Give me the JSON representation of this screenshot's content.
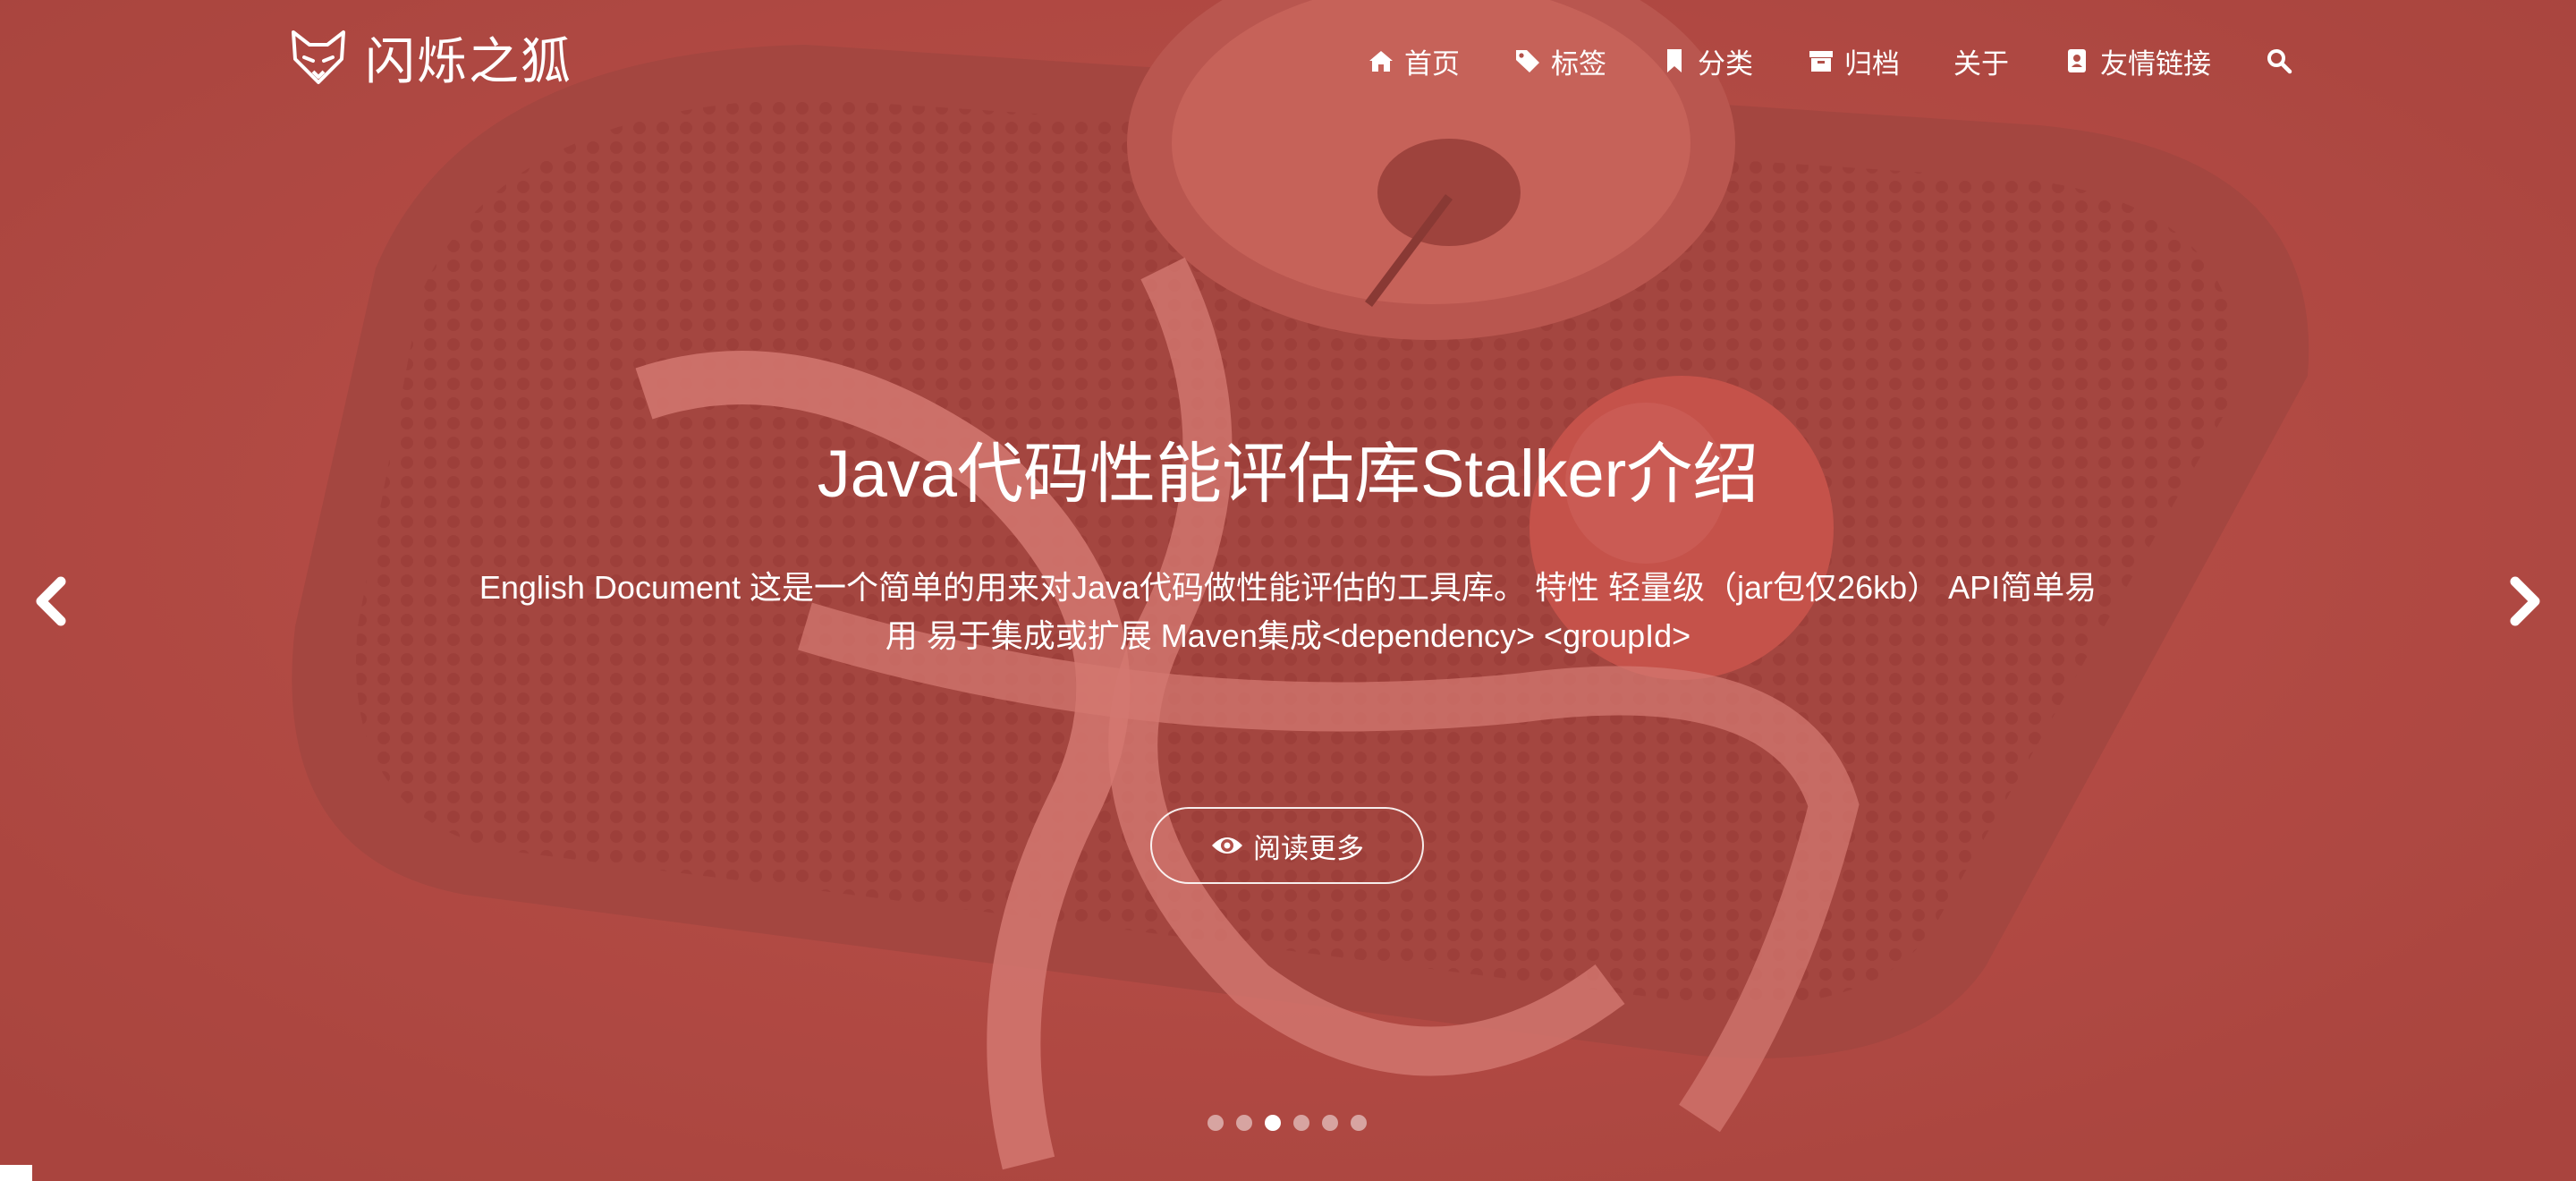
{
  "brand": {
    "name": "闪烁之狐",
    "logo_icon": "fox-head-icon"
  },
  "nav": {
    "items": [
      {
        "label": "首页",
        "icon": "home-icon"
      },
      {
        "label": "标签",
        "icon": "tags-icon"
      },
      {
        "label": "分类",
        "icon": "bookmark-icon"
      },
      {
        "label": "归档",
        "icon": "archive-icon"
      },
      {
        "label": "关于",
        "icon": ""
      },
      {
        "label": "友情链接",
        "icon": "address-card-icon"
      }
    ],
    "search_icon": "search-icon"
  },
  "carousel": {
    "title": "Java代码性能评估库Stalker介绍",
    "description": "English Document 这是一个简单的用来对Java代码做性能评估的工具库。 特性 轻量级（jar包仅26kb） API简单易用 易于集成或扩展 Maven集成<dependency> <groupId>",
    "read_more_label": "阅读更多",
    "read_more_icon": "eye-icon",
    "prev_icon": "chevron-left-icon",
    "next_icon": "chevron-right-icon",
    "slide_count": 6,
    "active_index": 2
  },
  "colors": {
    "overlay": "#c8504a",
    "background": "#a84942",
    "text": "#ffffff"
  }
}
